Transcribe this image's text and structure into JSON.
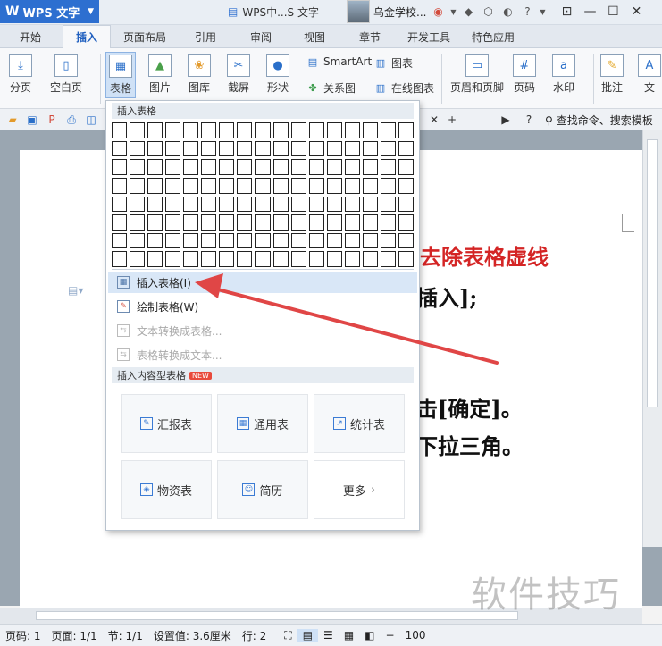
{
  "app": {
    "name": "WPS 文字",
    "doc_title": "WPS中...S 文字",
    "user": "乌金学校..."
  },
  "menu": {
    "tabs": [
      "开始",
      "插入",
      "页面布局",
      "引用",
      "审阅",
      "视图",
      "章节",
      "开发工具",
      "特色应用"
    ],
    "active": "插入"
  },
  "ribbon": {
    "page_break": "分页",
    "blank_page": "空白页",
    "table": "表格",
    "picture": "图片",
    "gallery": "图库",
    "screenshot": "截屏",
    "shape": "形状",
    "smartart": "SmartArt",
    "chart": "图表",
    "relation": "关系图",
    "online_chart": "在线图表",
    "header_footer": "页眉和页脚",
    "page_number": "页码",
    "watermark": "水印",
    "comment": "批注",
    "text": "文"
  },
  "quickbar": {
    "search": "查找命令、搜索模板"
  },
  "document": {
    "line_red": "去除表格虚线",
    "line2": "插入];",
    "line3": "击[确定]。",
    "line4": "下拉三角。"
  },
  "dropdown": {
    "header": "插入表格",
    "items": [
      {
        "label": "插入表格(I)",
        "state": "hover"
      },
      {
        "label": "绘制表格(W)",
        "state": "normal"
      },
      {
        "label": "文本转换成表格...",
        "state": "disabled"
      },
      {
        "label": "表格转换成文本...",
        "state": "disabled"
      }
    ],
    "content_header": "插入内容型表格",
    "new_badge": "NEW",
    "templates": [
      "汇报表",
      "通用表",
      "统计表",
      "物资表",
      "简历",
      "更多"
    ]
  },
  "status": {
    "page_num": "页码: 1",
    "page": "页面: 1/1",
    "section": "节: 1/1",
    "setting": "设置值: 3.6厘米",
    "row": "行: 2",
    "zoom": "100"
  },
  "watermark_text": "软件技巧",
  "colors": {
    "accent": "#2d6fd0",
    "red_text": "#d42525",
    "arrow": "#e04646"
  }
}
